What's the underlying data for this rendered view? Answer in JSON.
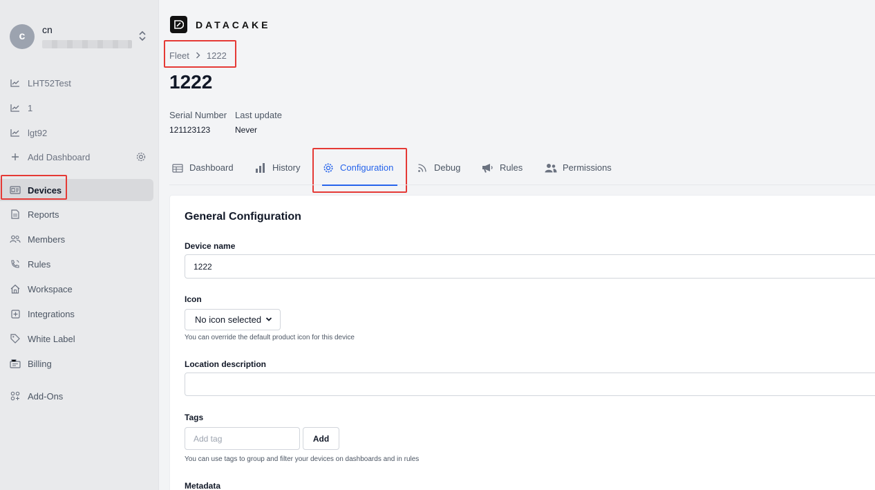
{
  "user": {
    "avatar_initial": "c",
    "name": "cn"
  },
  "sidebar": {
    "dashboards": [
      {
        "label": "LHT52Test",
        "icon": "chart-line-icon"
      },
      {
        "label": "1",
        "icon": "chart-line-icon"
      },
      {
        "label": "lgt92",
        "icon": "chart-line-icon"
      }
    ],
    "add_dashboard_label": "Add Dashboard",
    "items": [
      {
        "label": "Devices",
        "icon": "device-icon"
      },
      {
        "label": "Reports",
        "icon": "document-icon"
      },
      {
        "label": "Members",
        "icon": "users-icon"
      },
      {
        "label": "Rules",
        "icon": "rules-icon"
      },
      {
        "label": "Workspace",
        "icon": "home-icon"
      },
      {
        "label": "Integrations",
        "icon": "plus-square-icon"
      },
      {
        "label": "White Label",
        "icon": "tag-icon"
      },
      {
        "label": "Billing",
        "icon": "billing-icon"
      },
      {
        "label": "Add-Ons",
        "icon": "addons-icon"
      }
    ]
  },
  "brand": {
    "name": "DATACAKE"
  },
  "breadcrumb": {
    "parent": "Fleet",
    "current": "1222"
  },
  "page": {
    "title": "1222"
  },
  "meta": {
    "serial_label": "Serial Number",
    "serial_value": "121123123",
    "update_label": "Last update",
    "update_value": "Never"
  },
  "tabs": [
    {
      "label": "Dashboard",
      "icon": "table-icon"
    },
    {
      "label": "History",
      "icon": "bar-chart-icon"
    },
    {
      "label": "Configuration",
      "icon": "gear-icon"
    },
    {
      "label": "Debug",
      "icon": "rss-icon"
    },
    {
      "label": "Rules",
      "icon": "megaphone-icon"
    },
    {
      "label": "Permissions",
      "icon": "users-icon"
    }
  ],
  "config": {
    "title": "General Configuration",
    "device_name_label": "Device name",
    "device_name_value": "1222",
    "icon_label": "Icon",
    "icon_select_value": "No icon selected",
    "icon_hint": "You can override the default product icon for this device",
    "location_label": "Location description",
    "location_value": "",
    "tags_label": "Tags",
    "tags_placeholder": "Add tag",
    "tags_add_button": "Add",
    "tags_hint": "You can use tags to group and filter your devices on dashboards and in rules",
    "metadata_label": "Metadata"
  },
  "colors": {
    "accent": "#2563eb",
    "highlight": "#e53935"
  }
}
